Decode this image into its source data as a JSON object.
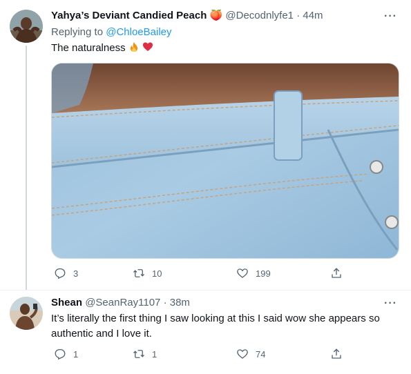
{
  "tweet1": {
    "display_name": "Yahya’s Deviant Candied Peach",
    "emoji": "🍑",
    "handle": "@Decodnlyfe1",
    "separator": "·",
    "time": "44m",
    "replying_prefix": "Replying to",
    "replying_to": "@ChloeBailey",
    "text": "The naturalness",
    "text_emoji_icons": [
      "fire-icon",
      "red-heart-icon"
    ],
    "replies": "3",
    "retweets": "10",
    "likes": "199",
    "media_description_icon": "denim-photo"
  },
  "tweet2": {
    "display_name": "Shean",
    "handle": "@SeanRay1107",
    "separator": "·",
    "time": "38m",
    "text": "It’s literally the first thing I saw looking at this I said wow she appears so authentic and I love it.",
    "replies": "1",
    "retweets": "1",
    "likes": "74"
  },
  "more_label": "···",
  "colors": {
    "link": "#1d9bf0",
    "muted": "#536471",
    "text": "#0f1419",
    "heart": "#e0245e",
    "fire": "#f4900c"
  }
}
